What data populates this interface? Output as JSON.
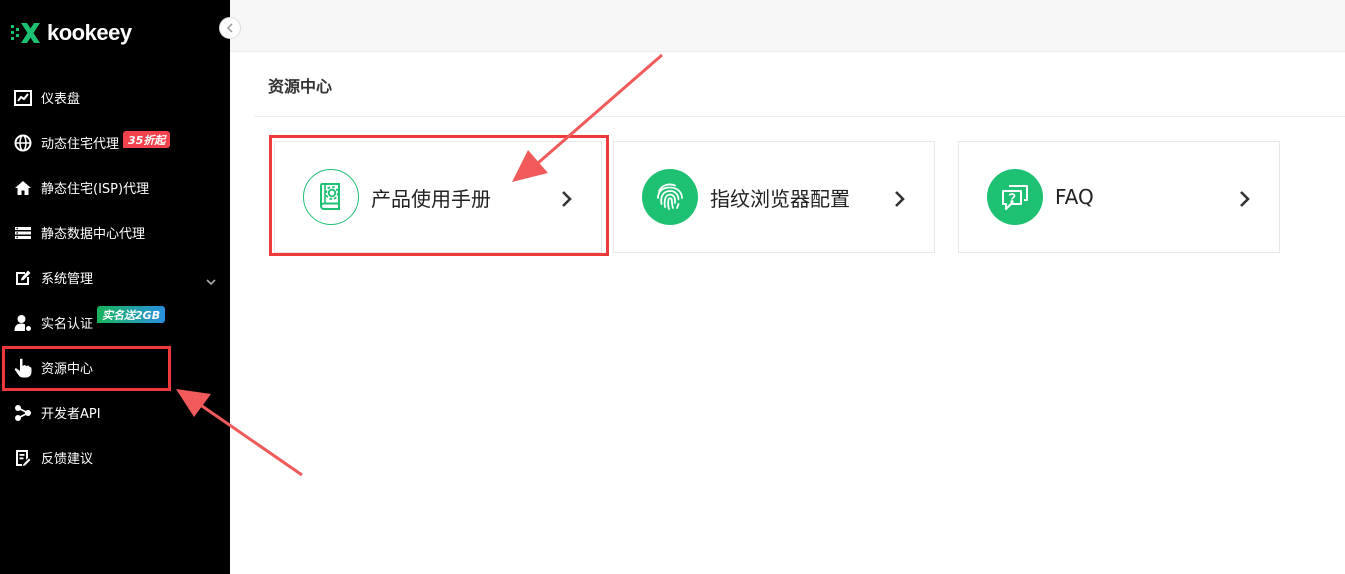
{
  "brand": {
    "name": "kookeey"
  },
  "colors": {
    "accent": "#1ec072",
    "highlight": "#ee3a3a",
    "sidebar_bg": "#000000"
  },
  "sidebar": {
    "items": [
      {
        "label": "仪表盘",
        "icon": "chart-icon"
      },
      {
        "label": "动态住宅代理",
        "icon": "globe-icon",
        "badge": "35折起"
      },
      {
        "label": "静态住宅(ISP)代理",
        "icon": "home-icon"
      },
      {
        "label": "静态数据中心代理",
        "icon": "server-icon"
      },
      {
        "label": "系统管理",
        "icon": "edit-icon",
        "has_submenu": true
      },
      {
        "label": "实名认证",
        "icon": "user-icon",
        "badge": "实名送2GB"
      },
      {
        "label": "资源中心",
        "icon": "hand-pointer-icon",
        "active": true
      },
      {
        "label": "开发者API",
        "icon": "share-nodes-icon"
      },
      {
        "label": "反馈建议",
        "icon": "feedback-icon"
      }
    ]
  },
  "main": {
    "title": "资源中心",
    "cards": [
      {
        "label": "产品使用手册",
        "icon": "manual-book-icon"
      },
      {
        "label": "指纹浏览器配置",
        "icon": "fingerprint-icon"
      },
      {
        "label": "FAQ",
        "icon": "faq-chat-icon"
      }
    ]
  }
}
